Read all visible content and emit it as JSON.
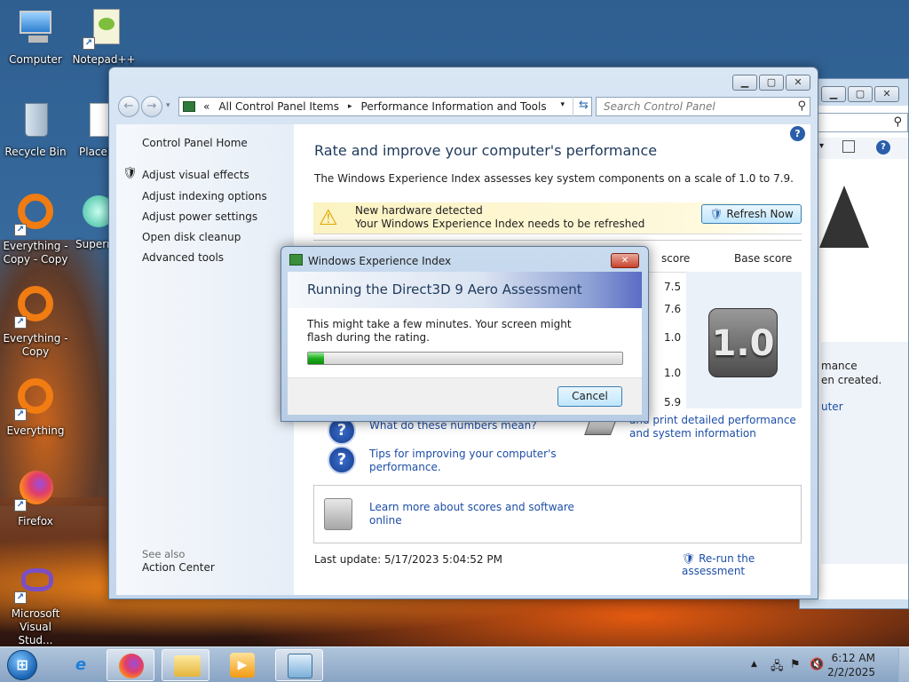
{
  "desktop": {
    "icons": [
      {
        "label": "Computer"
      },
      {
        "label": "Notepad++"
      },
      {
        "label": "Recycle Bin"
      },
      {
        "label": "Placel"
      },
      {
        "label": "Everything - Copy - Copy"
      },
      {
        "label": "Superm"
      },
      {
        "label": "Everything - Copy"
      },
      {
        "label": "Everything"
      },
      {
        "label": "Firefox"
      },
      {
        "label": "Microsoft Visual Stud..."
      }
    ]
  },
  "back_window": {
    "text_lines": [
      "mance",
      "en created.",
      "uter"
    ]
  },
  "main_window": {
    "address": {
      "chevron": "«",
      "segment1": "All Control Panel Items",
      "separator": "▸",
      "segment2": "Performance Information and Tools"
    },
    "search_placeholder": "Search Control Panel",
    "left_pane": {
      "home": "Control Panel Home",
      "links": [
        "Adjust visual effects",
        "Adjust indexing options",
        "Adjust power settings",
        "Open disk cleanup",
        "Advanced tools"
      ],
      "see_also_label": "See also",
      "see_also_links": [
        "Action Center"
      ]
    },
    "title": "Rate and improve your computer's performance",
    "description": "The Windows Experience Index assesses key system components on a scale of 1.0 to 7.9.",
    "notice": {
      "line1": "New hardware detected",
      "line2": "Your Windows Experience Index needs to be refreshed",
      "button": "Refresh Now"
    },
    "table": {
      "subscore_header": "score",
      "base_header": "Base score",
      "subscores": [
        "7.5",
        "7.6",
        "1.0",
        "1.0",
        "5.9"
      ],
      "base_score": "1.0"
    },
    "links": {
      "numbers_meaning": "What do these numbers mean?",
      "print_line1": "and print detailed performance",
      "print_line2": "and system information",
      "tips_line1": "Tips for improving your computer's",
      "tips_line2": "performance.",
      "learn_line1": "Learn more about scores and software",
      "learn_line2": "online"
    },
    "last_update": "Last update: 5/17/2023 5:04:52 PM",
    "rerun": "Re-run the assessment"
  },
  "dialog": {
    "title": "Windows Experience Index",
    "heading": "Running the Direct3D 9 Aero Assessment",
    "message": "This might take a few minutes. Your screen might flash during the rating.",
    "progress": 0.05,
    "cancel": "Cancel"
  },
  "taskbar": {
    "time": "6:12 AM",
    "date": "2/2/2025"
  },
  "colors": {
    "link": "#1d4ea7",
    "progress": "#20b020",
    "title_blue": "#1e395b"
  }
}
